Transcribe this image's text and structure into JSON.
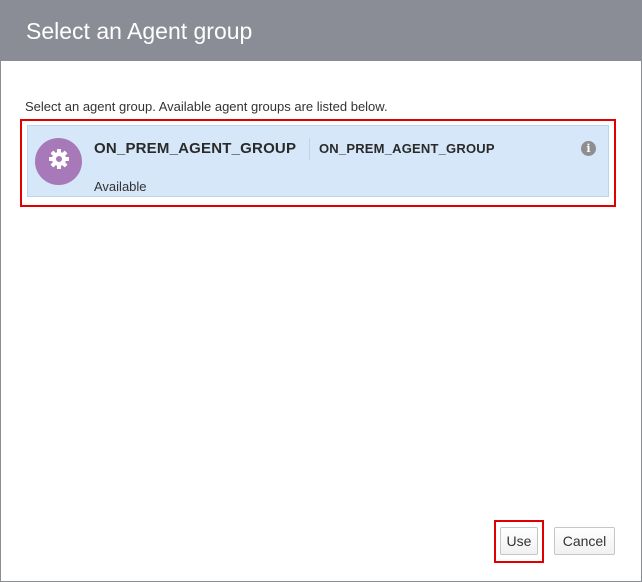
{
  "dialog": {
    "title": "Select an Agent group",
    "instruction": "Select an agent group. Available agent groups are listed below."
  },
  "agent_groups": [
    {
      "name": "ON_PREM_AGENT_GROUP",
      "id": "ON_PREM_AGENT_GROUP",
      "status": "Available",
      "icon": "gear-icon",
      "avatar_color": "#a779b8",
      "selected": true
    }
  ],
  "info_icon_glyph": "i",
  "buttons": {
    "use_label": "Use",
    "cancel_label": "Cancel"
  },
  "colors": {
    "header_bg": "#8a8d96",
    "selection_bg": "#d5e7f8",
    "highlight_border": "#e00000"
  }
}
